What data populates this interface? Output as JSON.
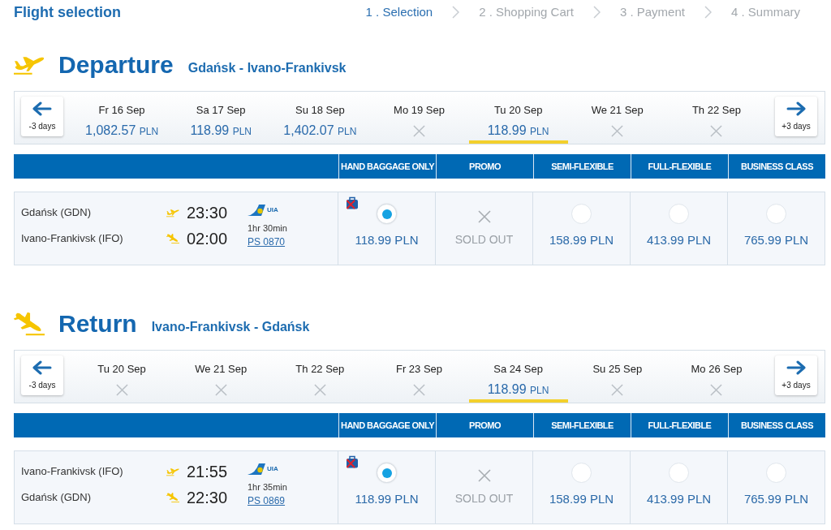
{
  "header": {
    "title": "Flight selection",
    "steps": [
      {
        "label": "1 . Selection",
        "selected": true
      },
      {
        "label": "2 . Shopping Cart",
        "selected": false
      },
      {
        "label": "3 . Payment",
        "selected": false
      },
      {
        "label": "4 . Summary",
        "selected": false
      }
    ]
  },
  "sections": [
    {
      "kind": "departure",
      "title": "Departure",
      "route": "Gdańsk - Ivano-Frankivsk",
      "date_bar": {
        "prev_button": "-3 days",
        "next_button": "+3 days",
        "dates": [
          {
            "day": "Fr 16 Sep",
            "available": true,
            "amount": "1,082.57",
            "currency": "PLN",
            "selected": false
          },
          {
            "day": "Sa 17 Sep",
            "available": true,
            "amount": "118.99",
            "currency": "PLN",
            "selected": false
          },
          {
            "day": "Su 18 Sep",
            "available": true,
            "amount": "1,402.07",
            "currency": "PLN",
            "selected": false
          },
          {
            "day": "Mo 19 Sep",
            "available": false,
            "selected": false
          },
          {
            "day": "Tu 20 Sep",
            "available": true,
            "amount": "118.99",
            "currency": "PLN",
            "selected": true
          },
          {
            "day": "We 21 Sep",
            "available": false,
            "selected": false
          },
          {
            "day": "Th 22 Sep",
            "available": false,
            "selected": false
          }
        ]
      },
      "fare_columns": [
        "HAND BAGGAGE ONLY",
        "PROMO",
        "SEMI-FLEXIBLE",
        "FULL-FLEXIBLE",
        "BUSINESS CLASS"
      ],
      "flight": {
        "origin": "Gdańsk (GDN)",
        "destination": "Ivano-Frankivsk (IFO)",
        "departure_time": "23:30",
        "arrival_time": "02:00",
        "airline": "UIA",
        "duration": "1hr 30min",
        "flight_number": "PS 0870",
        "fares": [
          {
            "kind": "available",
            "price": "118.99 PLN",
            "selected": true,
            "baggage_excluded": true
          },
          {
            "kind": "sold_out",
            "label": "SOLD OUT"
          },
          {
            "kind": "available",
            "price": "158.99 PLN",
            "selected": false,
            "baggage_excluded": false
          },
          {
            "kind": "available",
            "price": "413.99 PLN",
            "selected": false,
            "baggage_excluded": false
          },
          {
            "kind": "available",
            "price": "765.99 PLN",
            "selected": false,
            "baggage_excluded": false
          }
        ]
      }
    },
    {
      "kind": "return",
      "title": "Return",
      "route": "Ivano-Frankivsk - Gdańsk",
      "date_bar": {
        "prev_button": "-3 days",
        "next_button": "+3 days",
        "dates": [
          {
            "day": "Tu 20 Sep",
            "available": false,
            "selected": false
          },
          {
            "day": "We 21 Sep",
            "available": false,
            "selected": false
          },
          {
            "day": "Th 22 Sep",
            "available": false,
            "selected": false
          },
          {
            "day": "Fr 23 Sep",
            "available": false,
            "selected": false
          },
          {
            "day": "Sa 24 Sep",
            "available": true,
            "amount": "118.99",
            "currency": "PLN",
            "selected": true
          },
          {
            "day": "Su 25 Sep",
            "available": false,
            "selected": false
          },
          {
            "day": "Mo 26 Sep",
            "available": false,
            "selected": false
          }
        ]
      },
      "fare_columns": [
        "HAND BAGGAGE ONLY",
        "PROMO",
        "SEMI-FLEXIBLE",
        "FULL-FLEXIBLE",
        "BUSINESS CLASS"
      ],
      "flight": {
        "origin": "Ivano-Frankivsk (IFO)",
        "destination": "Gdańsk (GDN)",
        "departure_time": "21:55",
        "arrival_time": "22:30",
        "airline": "UIA",
        "duration": "1hr 35min",
        "flight_number": "PS 0869",
        "fares": [
          {
            "kind": "available",
            "price": "118.99 PLN",
            "selected": true,
            "baggage_excluded": true
          },
          {
            "kind": "sold_out",
            "label": "SOLD OUT"
          },
          {
            "kind": "available",
            "price": "158.99 PLN",
            "selected": false,
            "baggage_excluded": false
          },
          {
            "kind": "available",
            "price": "413.99 PLN",
            "selected": false,
            "baggage_excluded": false
          },
          {
            "kind": "available",
            "price": "765.99 PLN",
            "selected": false,
            "baggage_excluded": false
          }
        ]
      }
    }
  ]
}
